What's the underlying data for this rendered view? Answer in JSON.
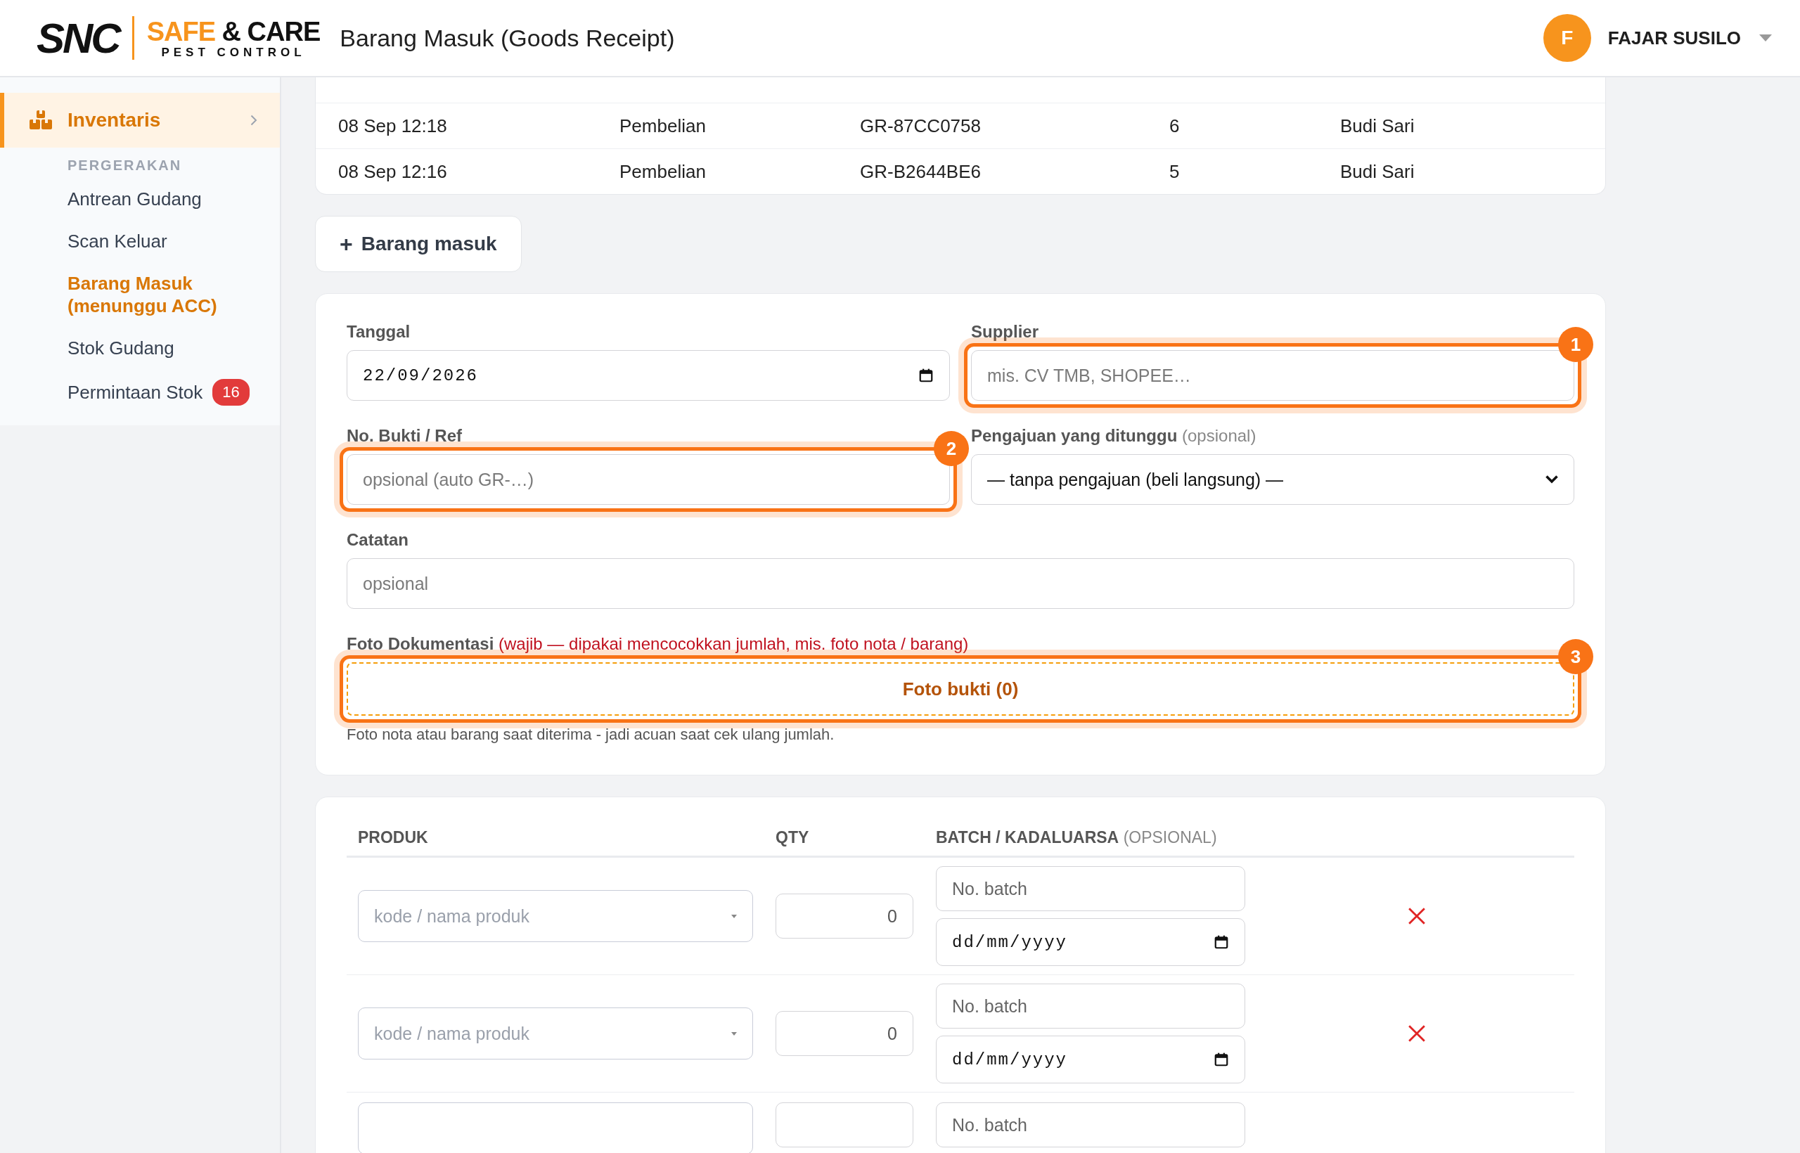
{
  "header": {
    "logo": {
      "mark": "SNC",
      "name_1": "SAFE",
      "name_2": "& CARE",
      "tagline": "PEST CONTROL"
    },
    "title": "Barang Masuk (Goods Receipt)",
    "user": {
      "initial": "F",
      "name": "FAJAR SUSILO"
    }
  },
  "sidebar": {
    "section": {
      "label": "Inventaris",
      "active": true
    },
    "group": "PERGERAKAN",
    "items": [
      {
        "label": "Antrean Gudang",
        "selected": false
      },
      {
        "label": "Scan Keluar",
        "selected": false
      },
      {
        "label": "Barang Masuk (menunggu ACC)",
        "selected": true
      },
      {
        "label": "Stok Gudang",
        "selected": false
      },
      {
        "label": "Permintaan Stok",
        "selected": false,
        "badge": "16"
      }
    ]
  },
  "recent_table": {
    "rows": [
      [
        "08 Sep 12:18",
        "Pembelian",
        "GR-87CC0758",
        "6",
        "Budi Sari"
      ],
      [
        "08 Sep 12:16",
        "Pembelian",
        "GR-B2644BE6",
        "5",
        "Budi Sari"
      ]
    ]
  },
  "add_button": {
    "icon": "+",
    "label": "Barang masuk"
  },
  "form": {
    "fields": [
      {
        "kind": "date",
        "label": "Tanggal",
        "value": "22/09/2026"
      },
      {
        "kind": "text",
        "label": "Supplier",
        "placeholder": "mis. CV TMB, SHOPEE…",
        "badge": "1"
      },
      {
        "kind": "text",
        "label": "No. Bukti / Ref",
        "placeholder": "opsional (auto GR-…)",
        "badge": "2"
      },
      {
        "kind": "select",
        "label": "Pengajuan yang ditunggu",
        "note": "(opsional)",
        "value": "— tanpa pengajuan (beli langsung) —"
      },
      {
        "kind": "wide",
        "label": "Catatan",
        "placeholder": "opsional"
      }
    ],
    "photo": {
      "label": "Foto Dokumentasi",
      "note": "(wajib — dipakai mencocokkan jumlah, mis. foto nota / barang)",
      "button": "Foto bukti (0)",
      "badge": "3",
      "help": "Foto nota atau barang saat diterima - jadi acuan saat cek ulang jumlah."
    }
  },
  "items_table": {
    "columns": [
      {
        "label": "PRODUK"
      },
      {
        "label": "QTY"
      },
      {
        "label": "BATCH / KADALUARSA",
        "note": "(OPSIONAL)"
      }
    ],
    "rows": [
      {
        "product_placeholder": "kode / nama produk",
        "qty": "0",
        "batch_placeholder": "No. batch",
        "date_placeholder": "dd/mm/yyyy"
      },
      {
        "product_placeholder": "kode / nama produk",
        "qty": "0",
        "batch_placeholder": "No. batch",
        "date_placeholder": "dd/mm/yyyy"
      },
      {
        "batch_placeholder": "No. batch"
      }
    ]
  }
}
